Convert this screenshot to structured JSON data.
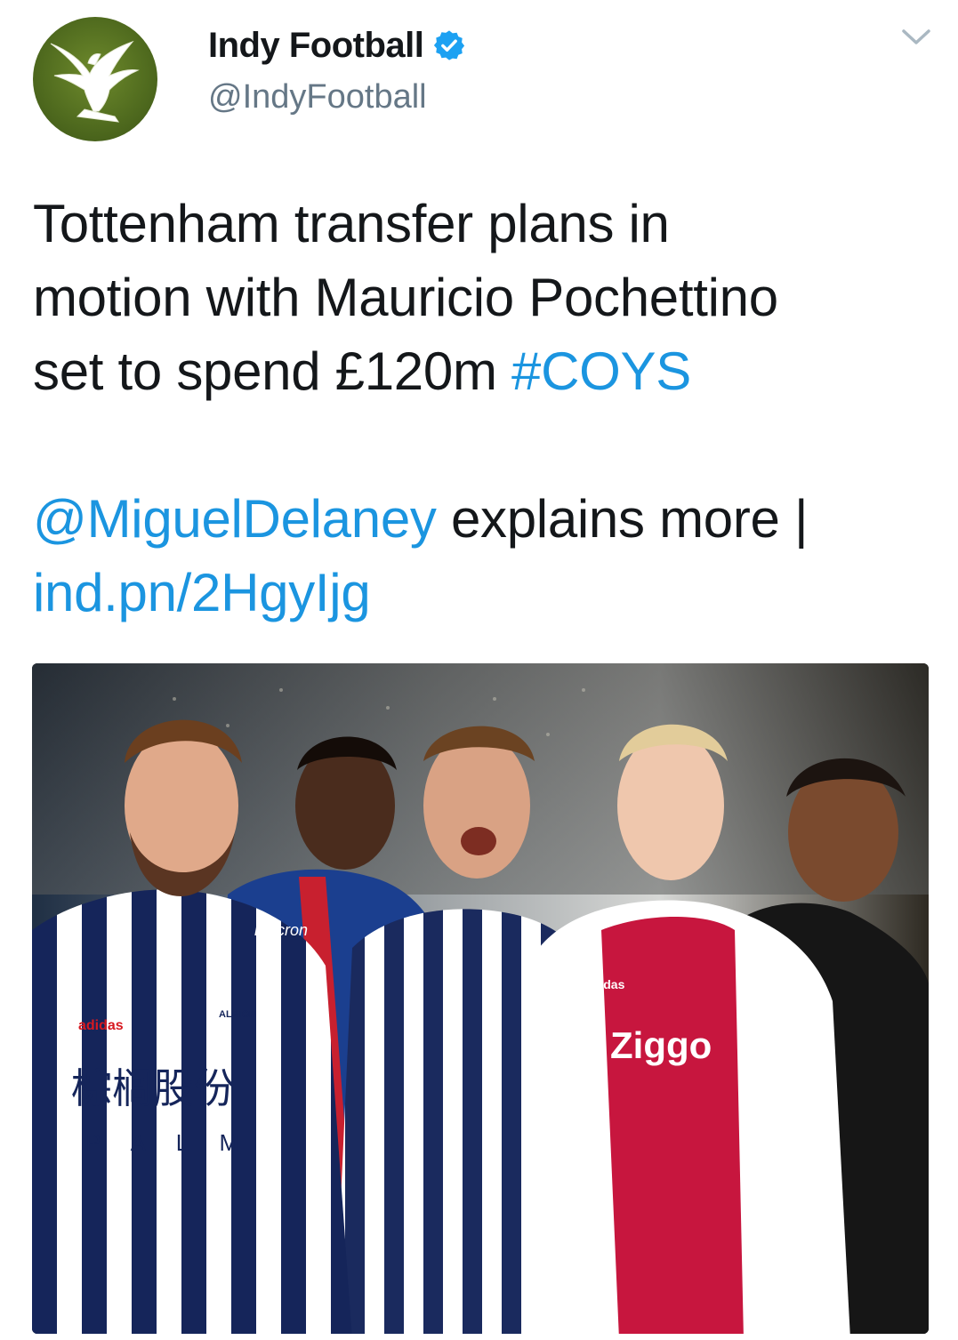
{
  "tweet": {
    "author": {
      "display_name": "Indy Football",
      "handle": "@IndyFootball",
      "verified": true,
      "avatar_icon": "eagle-logo-icon"
    },
    "menu_icon": "chevron-down-icon",
    "text": {
      "line1": "Tottenham transfer plans in",
      "line2": "motion with Mauricio Pochettino",
      "line3_prefix": "set to spend £120m ",
      "hashtag": "#COYS",
      "mention": "@MiguelDelaney",
      "mention_suffix": " explains more |",
      "short_link": "ind.pn/2HgyIjg"
    },
    "media": {
      "type": "photo",
      "jersey_texts": {
        "sponsor_chinese": "棕榈股份",
        "sponsor_palm": "P A L M",
        "albion_badge": "ALBION",
        "crystal_palace_sponsor": "macron",
        "ajax_sponsor": "Ziggo",
        "ajax_kit_brand": "adidas",
        "wba_kit_brand": "adidas"
      }
    }
  },
  "colors": {
    "link": "#1b95e0",
    "text": "#14171a",
    "secondary": "#657786",
    "verified": "#1da1f2"
  }
}
